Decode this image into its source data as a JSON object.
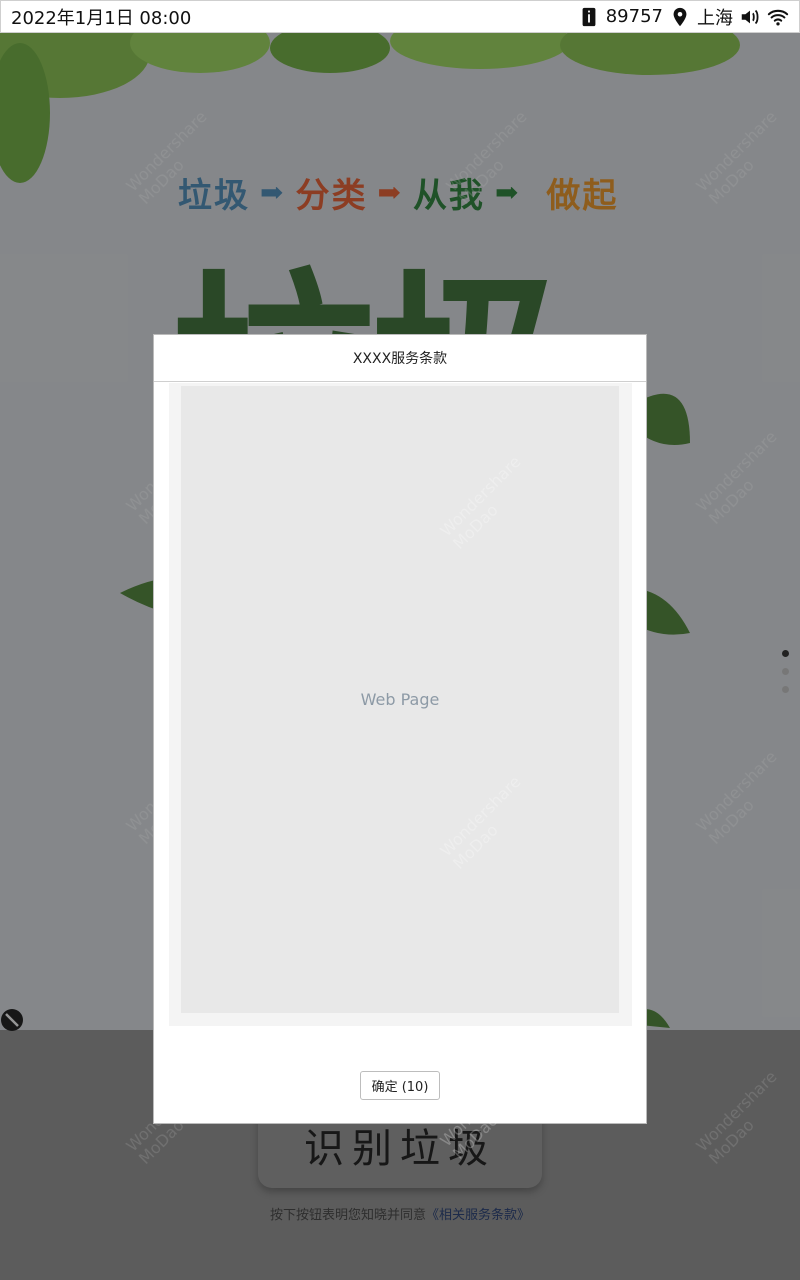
{
  "status_bar": {
    "datetime": "2022年1月1日 08:00",
    "counter": "89757",
    "location": "上海",
    "icons": [
      "info-card-icon",
      "location-pin-icon",
      "volume-icon",
      "wifi-icon"
    ]
  },
  "poster": {
    "slogan": {
      "part1": "垃圾",
      "part2": "分类",
      "part3": "从我",
      "part4": "做起",
      "arrow": "➡"
    },
    "big_title": "垃圾",
    "colors": {
      "slogan1": "#4c82a8",
      "slogan2": "#cf5a34",
      "slogan3": "#2f7a3c",
      "slogan4": "#d28a2c",
      "big_title": "#3f6b3a"
    }
  },
  "main": {
    "identify_button_label": "识别垃圾",
    "agreement_prefix": "按下按钮表明您知晓并同意",
    "agreement_link": "《相关服务条款》"
  },
  "watermark": {
    "line1": "Wondershare",
    "line2": "MoDao"
  },
  "modal": {
    "title": "XXXX服务条款",
    "webpage_placeholder": "Web Page",
    "confirm_label": "确定 (10)"
  },
  "pager": {
    "count": 3,
    "active_index": 0
  }
}
